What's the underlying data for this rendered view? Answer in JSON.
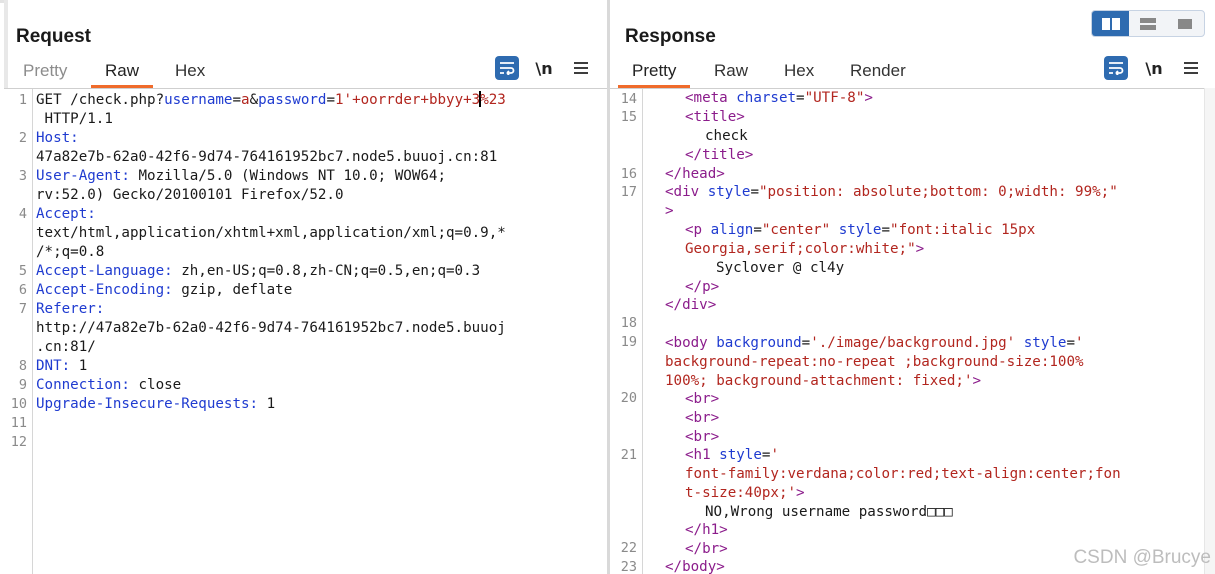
{
  "request": {
    "title": "Request",
    "tabs": [
      "Pretty",
      "Raw",
      "Hex"
    ],
    "active_tab": "Raw",
    "toolbar": {
      "wrap_icon": "wrap-text-icon",
      "newline_label": "\\n",
      "menu_icon": "hamburger-menu-icon"
    },
    "line_numbers": [
      "1",
      "2",
      "3",
      "4",
      "5",
      "6",
      "7",
      "8",
      "9",
      "10",
      "11",
      "12"
    ]
  },
  "response": {
    "title": "Response",
    "tabs": [
      "Pretty",
      "Raw",
      "Hex",
      "Render"
    ],
    "active_tab": "Pretty",
    "toolbar": {
      "wrap_icon": "wrap-text-icon",
      "newline_label": "\\n",
      "menu_icon": "hamburger-menu-icon"
    },
    "line_numbers": [
      "14",
      "15",
      "16",
      "17",
      "18",
      "19",
      "20",
      "21",
      "22",
      "23"
    ]
  },
  "layout_switcher": {
    "options": [
      "side-by-side-icon",
      "top-bottom-icon",
      "single-pane-icon"
    ],
    "active": "side-by-side-icon"
  },
  "watermark": "CSDN @Brucye",
  "colors": {
    "accent": "#f06b2b",
    "button_blue": "#2e6bb0",
    "keyword": "#1f3bd0",
    "value": "#b2261f",
    "tag": "#8b1c8b"
  }
}
